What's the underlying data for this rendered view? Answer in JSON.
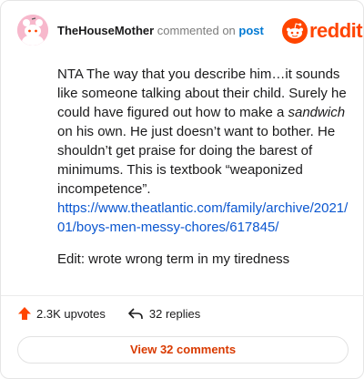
{
  "header": {
    "username": "TheHouseMother",
    "action": "commented on",
    "target": "post",
    "logo_text": "reddit"
  },
  "comment": {
    "text_before": "NTA The way that you describe him…it sounds like someone talking about their child. Surely he could have figured out how to make a ",
    "text_italic": "sandwich",
    "text_after": " on his own. He just doesn’t want to bother. He shouldn’t get praise for doing the barest of minimums. This is textbook “weaponized incompetence”.",
    "link": "https://www.theatlantic.com/family/archive/2021/01/boys-men-messy-chores/617845/",
    "edit": "Edit: wrote wrong term in my tiredness"
  },
  "footer": {
    "upvotes": "2.3K upvotes",
    "replies": "32 replies",
    "view_comments": "View 32 comments"
  },
  "colors": {
    "brand": "#ff4500",
    "link": "#0b57d0",
    "view_button_text": "#d93a00"
  },
  "icons": [
    "avatar-icon",
    "reddit-logo-icon",
    "upvote-arrow-icon",
    "reply-arrow-icon"
  ]
}
